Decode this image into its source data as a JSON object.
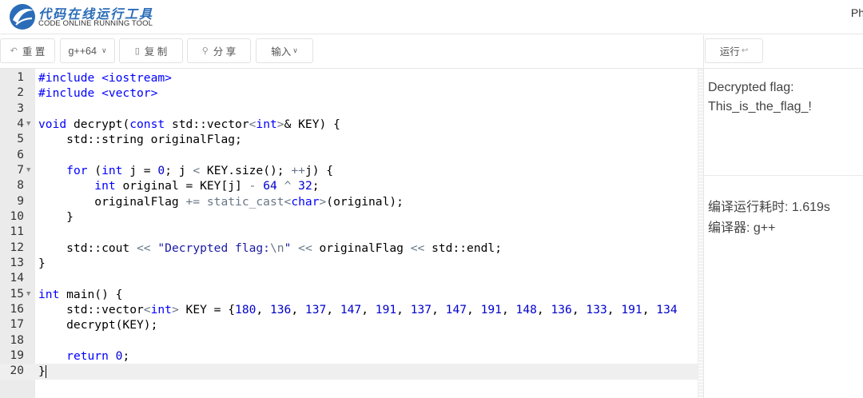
{
  "header": {
    "logo_cn": "代码在线运行工具",
    "logo_en": "CODE ONLINE RUNNING TOOL",
    "right_text": "Ph"
  },
  "toolbar": {
    "reset_label": "重 置",
    "lang_label": "g++64",
    "copy_label": "复 制",
    "share_label": "分 享",
    "input_label": "输入",
    "run_label": "运行"
  },
  "editor": {
    "lines": [
      {
        "n": "1",
        "fold": false
      },
      {
        "n": "2",
        "fold": false
      },
      {
        "n": "3",
        "fold": false
      },
      {
        "n": "4",
        "fold": true
      },
      {
        "n": "5",
        "fold": false
      },
      {
        "n": "6",
        "fold": false
      },
      {
        "n": "7",
        "fold": true
      },
      {
        "n": "8",
        "fold": false
      },
      {
        "n": "9",
        "fold": false
      },
      {
        "n": "10",
        "fold": false
      },
      {
        "n": "11",
        "fold": false
      },
      {
        "n": "12",
        "fold": false
      },
      {
        "n": "13",
        "fold": false
      },
      {
        "n": "14",
        "fold": false
      },
      {
        "n": "15",
        "fold": true
      },
      {
        "n": "16",
        "fold": false
      },
      {
        "n": "17",
        "fold": false
      },
      {
        "n": "18",
        "fold": false
      },
      {
        "n": "19",
        "fold": false
      },
      {
        "n": "20",
        "fold": false
      }
    ],
    "code": [
      [
        [
          "pp",
          "#include <iostream>"
        ]
      ],
      [
        [
          "pp",
          "#include <vector>"
        ]
      ],
      [],
      [
        [
          "ty",
          "void"
        ],
        [
          "t",
          " decrypt("
        ],
        [
          "ty",
          "const"
        ],
        [
          "t",
          " std::vector"
        ],
        [
          "op",
          "<"
        ],
        [
          "ty",
          "int"
        ],
        [
          "op",
          ">"
        ],
        [
          "t",
          "& KEY) {"
        ]
      ],
      [
        [
          "t",
          "    std::string originalFlag;"
        ]
      ],
      [],
      [
        [
          "t",
          "    "
        ],
        [
          "kw",
          "for"
        ],
        [
          "t",
          " ("
        ],
        [
          "ty",
          "int"
        ],
        [
          "t",
          " j = "
        ],
        [
          "num",
          "0"
        ],
        [
          "t",
          "; j "
        ],
        [
          "op",
          "<"
        ],
        [
          "t",
          " KEY.size(); "
        ],
        [
          "op",
          "++"
        ],
        [
          "t",
          "j) {"
        ]
      ],
      [
        [
          "t",
          "        "
        ],
        [
          "ty",
          "int"
        ],
        [
          "t",
          " original = KEY[j] "
        ],
        [
          "op",
          "-"
        ],
        [
          "t",
          " "
        ],
        [
          "num",
          "64"
        ],
        [
          "t",
          " "
        ],
        [
          "op",
          "^"
        ],
        [
          "t",
          " "
        ],
        [
          "num",
          "32"
        ],
        [
          "t",
          ";"
        ]
      ],
      [
        [
          "t",
          "        originalFlag "
        ],
        [
          "op",
          "+="
        ],
        [
          "t",
          " "
        ],
        [
          "op",
          "static_cast"
        ],
        [
          "op",
          "<"
        ],
        [
          "ty",
          "char"
        ],
        [
          "op",
          ">"
        ],
        [
          "t",
          "(original);"
        ]
      ],
      [
        [
          "t",
          "    }"
        ]
      ],
      [],
      [
        [
          "t",
          "    std::cout "
        ],
        [
          "op",
          "<<"
        ],
        [
          "t",
          " "
        ],
        [
          "str",
          "\"Decrypted flag:"
        ],
        [
          "op",
          "\\n"
        ],
        [
          "str",
          "\""
        ],
        [
          "t",
          " "
        ],
        [
          "op",
          "<<"
        ],
        [
          "t",
          " originalFlag "
        ],
        [
          "op",
          "<<"
        ],
        [
          "t",
          " std::endl;"
        ]
      ],
      [
        [
          "t",
          "}"
        ]
      ],
      [],
      [
        [
          "ty",
          "int"
        ],
        [
          "t",
          " main() {"
        ]
      ],
      [
        [
          "t",
          "    std::vector"
        ],
        [
          "op",
          "<"
        ],
        [
          "ty",
          "int"
        ],
        [
          "op",
          ">"
        ],
        [
          "t",
          " KEY = {"
        ],
        [
          "num",
          "180"
        ],
        [
          "t",
          ", "
        ],
        [
          "num",
          "136"
        ],
        [
          "t",
          ", "
        ],
        [
          "num",
          "137"
        ],
        [
          "t",
          ", "
        ],
        [
          "num",
          "147"
        ],
        [
          "t",
          ", "
        ],
        [
          "num",
          "191"
        ],
        [
          "t",
          ", "
        ],
        [
          "num",
          "137"
        ],
        [
          "t",
          ", "
        ],
        [
          "num",
          "147"
        ],
        [
          "t",
          ", "
        ],
        [
          "num",
          "191"
        ],
        [
          "t",
          ", "
        ],
        [
          "num",
          "148"
        ],
        [
          "t",
          ", "
        ],
        [
          "num",
          "136"
        ],
        [
          "t",
          ", "
        ],
        [
          "num",
          "133"
        ],
        [
          "t",
          ", "
        ],
        [
          "num",
          "191"
        ],
        [
          "t",
          ", "
        ],
        [
          "num",
          "134"
        ]
      ],
      [
        [
          "t",
          "    decrypt(KEY);"
        ]
      ],
      [],
      [
        [
          "t",
          "    "
        ],
        [
          "kw",
          "return"
        ],
        [
          "t",
          " "
        ],
        [
          "num",
          "0"
        ],
        [
          "t",
          ";"
        ]
      ],
      [
        [
          "t",
          "}"
        ]
      ]
    ]
  },
  "output": {
    "line1": "Decrypted flag:",
    "line2": "This_is_the_flag_!",
    "time_label": "编译运行耗时: 1.619s",
    "compiler_label": "编译器: g++"
  },
  "colors": {
    "keyword": "#0000ff",
    "number": "#0000cd",
    "string": "#1a1aa6",
    "operator": "#687687",
    "logo_blue": "#2b6cb8"
  }
}
